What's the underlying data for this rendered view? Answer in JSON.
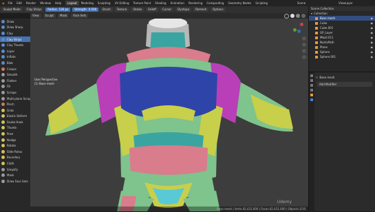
{
  "menubar": {
    "menus": [
      "File",
      "Edit",
      "Render",
      "Window",
      "Help"
    ],
    "workspaces": [
      "Layout",
      "Modeling",
      "Sculpting",
      "UV Editing",
      "Texture Paint",
      "Shading",
      "Animation",
      "Rendering",
      "Compositing",
      "Geometry Nodes",
      "Scripting"
    ],
    "active_workspace": "Layout",
    "scene": "Scene",
    "view_layer": "ViewLayer"
  },
  "tool_header": {
    "mode": "Sculpt Mode",
    "brush": "Clay Strips",
    "radius_label": "Radius",
    "radius_value": "136 px",
    "strength_label": "Strength",
    "strength_value": "0.500",
    "brush_menu": "Brush",
    "texture_menu": "Texture",
    "stroke_menu": "Stroke",
    "falloff_menu": "Falloff",
    "cursor_menu": "Cursor",
    "dyntopo": "Dyntopo",
    "remesh": "Remesh",
    "options": "Options",
    "view_menus": [
      "View",
      "Sculpt",
      "Mask",
      "Face Sets"
    ]
  },
  "tools": [
    {
      "label": "Draw",
      "color": "#5b8ccc"
    },
    {
      "label": "Draw Sharp",
      "color": "#5b8ccc"
    },
    {
      "label": "Clay",
      "color": "#5b8ccc"
    },
    {
      "label": "Clay Strips",
      "color": "#5b8ccc"
    },
    {
      "label": "Clay Thumb",
      "color": "#5b8ccc"
    },
    {
      "label": "Layer",
      "color": "#5b8ccc"
    },
    {
      "label": "Inflate",
      "color": "#5b8ccc"
    },
    {
      "label": "Blob",
      "color": "#5b8ccc"
    },
    {
      "label": "Crease",
      "color": "#cc7a5b"
    },
    {
      "label": "Smooth",
      "color": "#9a9a9a"
    },
    {
      "label": "Flatten",
      "color": "#9a9a9a"
    },
    {
      "label": "Fill",
      "color": "#9a9a9a"
    },
    {
      "label": "Scrape",
      "color": "#9a9a9a"
    },
    {
      "label": "Multi-plane Scrape",
      "color": "#9a9a9a"
    },
    {
      "label": "Pinch",
      "color": "#cc7a5b"
    },
    {
      "label": "Grab",
      "color": "#d4c15b"
    },
    {
      "label": "Elastic Deform",
      "color": "#d4c15b"
    },
    {
      "label": "Snake Hook",
      "color": "#d4c15b"
    },
    {
      "label": "Thumb",
      "color": "#d4c15b"
    },
    {
      "label": "Pose",
      "color": "#d4c15b"
    },
    {
      "label": "Nudge",
      "color": "#d4c15b"
    },
    {
      "label": "Rotate",
      "color": "#d4c15b"
    },
    {
      "label": "Slide Relax",
      "color": "#d4c15b"
    },
    {
      "label": "Boundary",
      "color": "#d4c15b"
    },
    {
      "label": "Cloth",
      "color": "#d4c15b"
    },
    {
      "label": "Simplify",
      "color": "#9a9a9a"
    },
    {
      "label": "Mask",
      "color": "#9a9a9a"
    },
    {
      "label": "Draw Face Sets",
      "color": "#9a9a9a"
    }
  ],
  "active_tool": "Clay Strips",
  "viewport": {
    "view_name": "User Perspective",
    "object_name": "(1) Base mesh",
    "status": "Base mesh | Verts:42,431,000 | Faces:42,431,000 | Objects:1/10"
  },
  "outliner": {
    "title": "Scene Collection",
    "collection": "Collection",
    "items": [
      "Base mesh",
      "Cube",
      "Cube.001",
      "GP_Layer",
      "Mball.011",
      "NurbsPath",
      "Plane",
      "Sphere",
      "Sphere.001"
    ],
    "selected": "Base mesh"
  },
  "properties": {
    "object": "Base mesh",
    "add_modifier": "Add Modifier"
  },
  "watermark": "Udemy",
  "colors": {
    "accent": "#4772b3",
    "skin_green": "#7fc38d",
    "chest_blue": "#2f44a8",
    "shoulder_magenta": "#b83fb8",
    "yellow": "#c8cf4a",
    "pink": "#d97c8c",
    "teal": "#3aa5a0"
  }
}
